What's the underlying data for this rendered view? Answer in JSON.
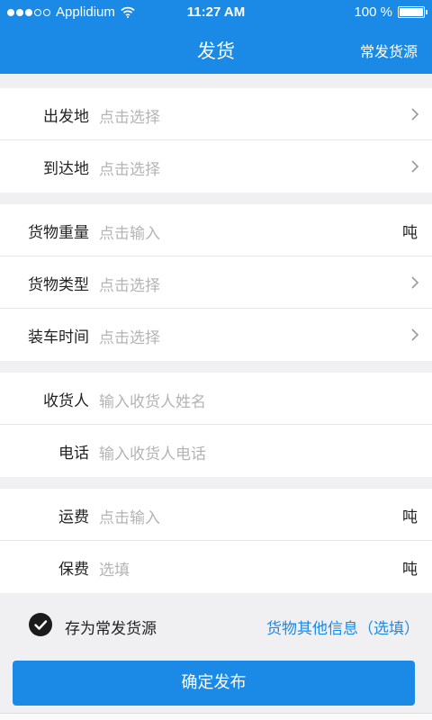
{
  "status_bar": {
    "carrier": "Applidium",
    "time": "11:27 AM",
    "battery": "100 %"
  },
  "nav": {
    "title": "发货",
    "right_action": "常发货源"
  },
  "groups": [
    [
      {
        "label": "出发地",
        "value": "点击选择",
        "accessory": "chevron"
      },
      {
        "label": "到达地",
        "value": "点击选择",
        "accessory": "chevron"
      }
    ],
    [
      {
        "label": "货物重量",
        "value": "点击输入",
        "accessory": "unit",
        "unit": "吨"
      },
      {
        "label": "货物类型",
        "value": "点击选择",
        "accessory": "chevron"
      },
      {
        "label": "装车时间",
        "value": "点击选择",
        "accessory": "chevron"
      }
    ],
    [
      {
        "label": "收货人",
        "value": "输入收货人姓名",
        "accessory": "none"
      },
      {
        "label": "电话",
        "value": "输入收货人电话",
        "accessory": "none"
      }
    ],
    [
      {
        "label": "运费",
        "value": "点击输入",
        "accessory": "unit",
        "unit": "吨"
      },
      {
        "label": "保费",
        "value": "选填",
        "accessory": "unit",
        "unit": "吨"
      }
    ]
  ],
  "options": {
    "save_label": "存为常发货源",
    "save_checked": true,
    "other_info": "货物其他信息（选填）"
  },
  "submit_label": "确定发布",
  "colors": {
    "brand": "#1a8ae6",
    "placeholder": "#b4b4b4"
  }
}
